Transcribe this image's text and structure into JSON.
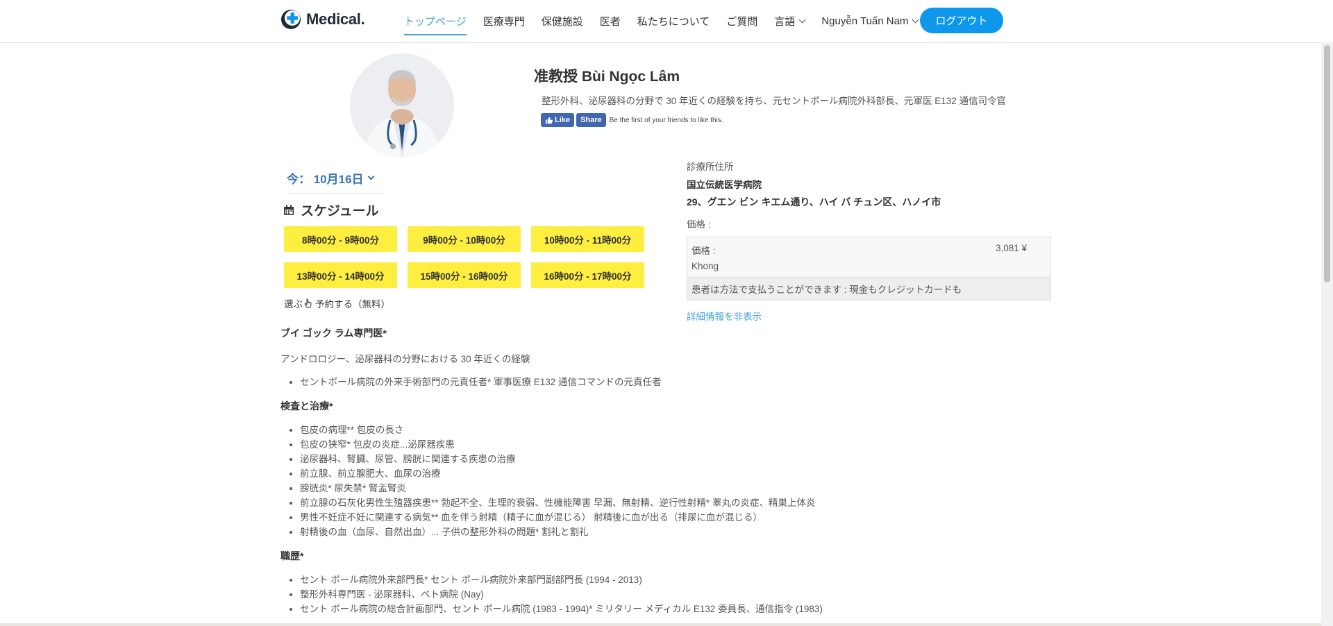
{
  "header": {
    "logo_text": "Medical.",
    "nav": [
      "トップページ",
      "医療専門",
      "保健施設",
      "医者",
      "私たちについて",
      "ご質問"
    ],
    "language_label": "言語",
    "user_name": "Nguyễn Tuấn Nam",
    "logout_label": "ログアウト",
    "brand_color": "#0d98eb"
  },
  "doctor": {
    "name": "准教授 Bùi Ngọc Lâm",
    "description": "整形外科、泌尿器科の分野で 30 年近くの経験を持ち、元セントポール病院外科部長、元軍医 E132 通信司令官",
    "fb_like": "Like",
    "fb_share": "Share",
    "fb_note": "Be the first of your friends to like this."
  },
  "schedule": {
    "date_label": "今： 10月16日",
    "title": "スケジュール",
    "slots": [
      "8時00分 - 9時00分",
      "9時00分 - 10時00分",
      "10時00分 - 11時00分",
      "13時00分 - 14時00分",
      "15時00分 - 16時00分",
      "16時00分 - 17時00分"
    ],
    "note_prefix": "選ぶ",
    "note_suffix": "予約する（無料）",
    "slot_color": "#fdee3f"
  },
  "clinic": {
    "address_label": "診療所住所",
    "name": "国立伝統医学病院",
    "address": "29、グエン ビン キエム通り、ハイ バ チュン区、ハノイ市",
    "price_label": "価格 :",
    "price_row_label": "価格 :",
    "price_value": "3,081 ¥",
    "price_note": "Khong",
    "payment_note": "患者は方法で支払うことができます : 現金もクレジットカードも",
    "hide_details": "詳細情報を非表示"
  },
  "details": {
    "heading1": "ブイ ゴック ラム専門医*",
    "intro": "アンドロロジー、泌尿器科の分野における 30 年近くの経験",
    "list1": [
      "セントポール病院の外来手術部門の元責任者* 軍事医療 E132 通信コマンドの元責任者"
    ],
    "heading2": "検査と治療*",
    "list2": [
      "包皮の病理** 包皮の長さ",
      "包皮の狭窄* 包皮の炎症...泌尿器疾患",
      "泌尿器科、腎臓、尿管、膀胱に関連する疾患の治療",
      "前立腺、前立腺肥大、血尿の治療",
      "膀胱炎* 尿失禁* 腎盂腎炎",
      "前立腺の石灰化男性生殖器疾患** 勃起不全、生理的衰弱、性機能障害 早漏、無射精、逆行性射精* 睾丸の炎症、精巣上体炎",
      "男性不妊症不妊に関連する病気** 血を伴う射精（精子に血が混じる） 射精後に血が出る（排尿に血が混じる）",
      "射精後の血（血尿、自然出血）... 子供の整形外科の問題* 割礼と割礼"
    ],
    "heading3": "職歴*",
    "list3": [
      "セント ポール病院外来部門長* セント ポール病院外来部門副部門長 (1994 - 2013)",
      "整形外科専門医 - 泌尿器科、ベト病院 (Nay)",
      "セント ポール病院の総合計画部門、セント ポール病院 (1983 - 1994)* ミリタリー メディカル E132 委員長、通信指令 (1983)"
    ]
  }
}
